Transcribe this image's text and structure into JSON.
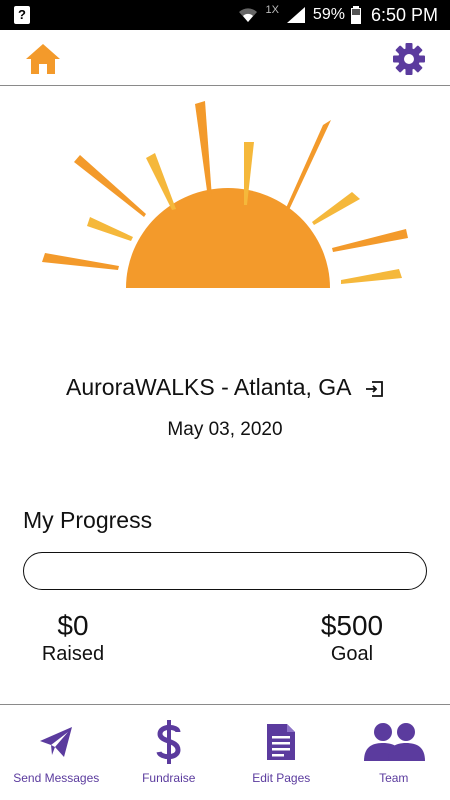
{
  "status_bar": {
    "network_label": "1X",
    "battery": "59%",
    "time": "6:50 PM",
    "left_icon_glyph": "?"
  },
  "header": {
    "home_icon": "home-icon",
    "settings_icon": "gear-icon"
  },
  "event": {
    "title": "AuroraWALKS - Atlanta, GA",
    "date": "May 03, 2020",
    "action_icon": "sign-in-icon"
  },
  "progress": {
    "title": "My Progress",
    "fraction": 0,
    "raised_amount": "$0",
    "raised_label": "Raised",
    "goal_amount": "$500",
    "goal_label": "Goal"
  },
  "nav": [
    {
      "label": "Send Messages",
      "icon": "paper-plane-icon"
    },
    {
      "label": "Fundraise",
      "icon": "dollar-icon"
    },
    {
      "label": "Edit Pages",
      "icon": "document-icon"
    },
    {
      "label": "Team",
      "icon": "team-icon"
    }
  ],
  "colors": {
    "accent_orange": "#f39a2b",
    "ray_yellow": "#f5b83b",
    "purple": "#5b3b9e"
  }
}
